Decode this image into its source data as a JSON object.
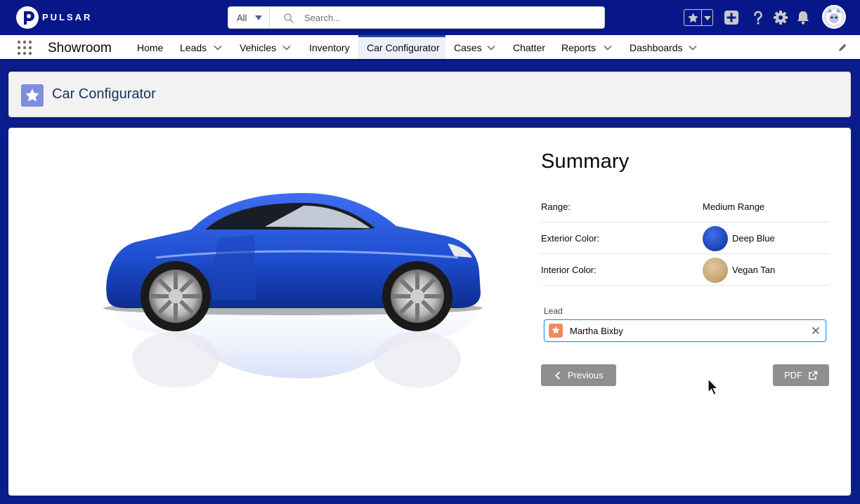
{
  "header": {
    "brand": "PULSAR",
    "search": {
      "scope": "All",
      "placeholder": "Search..."
    },
    "icons": [
      "favorites-star-icon",
      "add-icon",
      "help-icon",
      "setup-gear-icon",
      "notifications-bell-icon",
      "user-avatar"
    ]
  },
  "nav": {
    "app_name": "Showroom",
    "items": [
      {
        "label": "Home",
        "has_menu": false,
        "active": false
      },
      {
        "label": "Leads",
        "has_menu": true,
        "active": false
      },
      {
        "label": "Vehicles",
        "has_menu": true,
        "active": false
      },
      {
        "label": "Inventory",
        "has_menu": false,
        "active": false
      },
      {
        "label": "Car Configurator",
        "has_menu": false,
        "active": true
      },
      {
        "label": "Cases",
        "has_menu": true,
        "active": false
      },
      {
        "label": "Chatter",
        "has_menu": false,
        "active": false
      },
      {
        "label": "Reports",
        "has_menu": true,
        "active": false
      },
      {
        "label": "Dashboards",
        "has_menu": true,
        "active": false
      }
    ]
  },
  "page_header": {
    "title": "Car Configurator",
    "icon": "star-icon"
  },
  "summary": {
    "title": "Summary",
    "rows": [
      {
        "label": "Range:",
        "value": "Medium Range"
      },
      {
        "label": "Exterior Color:",
        "value": "Deep Blue",
        "swatch": "#1f48b8"
      },
      {
        "label": "Interior Color:",
        "value": "Vegan Tan",
        "swatch": "#c8a878"
      }
    ],
    "lead": {
      "label": "Lead",
      "value": "Martha Bixby"
    },
    "buttons": {
      "previous": "Previous",
      "pdf": "PDF"
    }
  },
  "colors": {
    "brand_navy": "#07178a",
    "page_header_icon": "#7f8de1",
    "lead_icon": "#f08a5d",
    "button_gray": "#8f8f8f",
    "car_blue": "#1f4fd1"
  }
}
